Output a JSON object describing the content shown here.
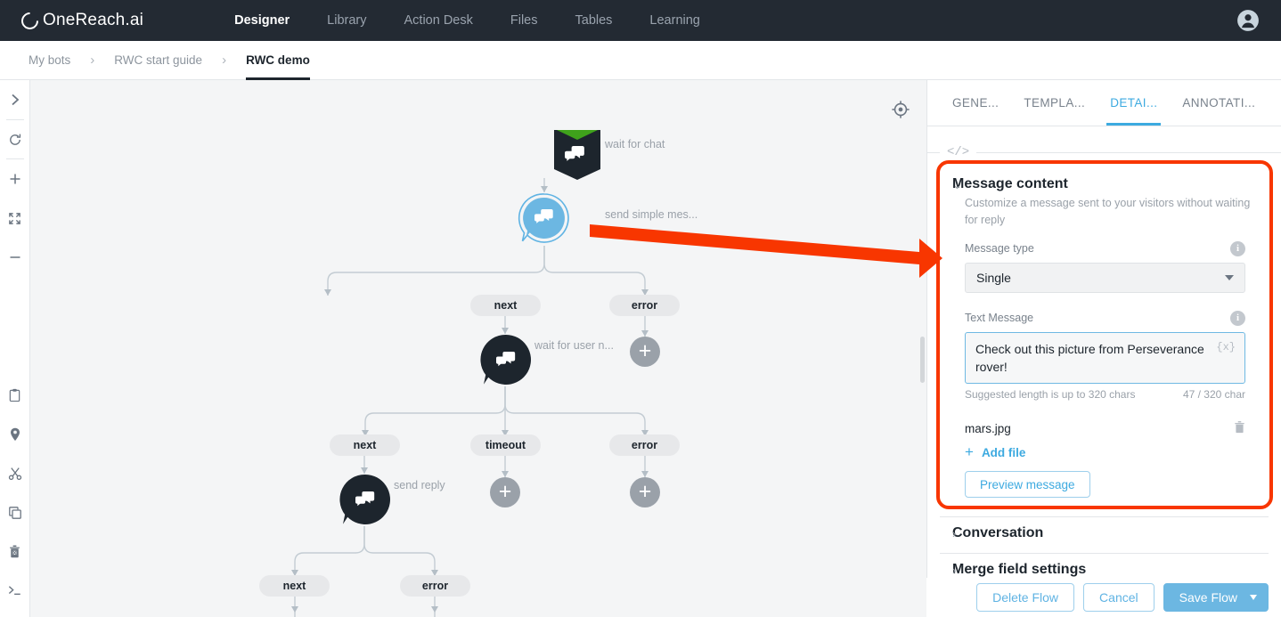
{
  "app": {
    "logo_text": "OneReach.ai"
  },
  "nav": {
    "items": [
      {
        "label": "Designer",
        "active": true
      },
      {
        "label": "Library",
        "active": false
      },
      {
        "label": "Action Desk",
        "active": false
      },
      {
        "label": "Files",
        "active": false
      },
      {
        "label": "Tables",
        "active": false
      },
      {
        "label": "Learning",
        "active": false
      }
    ]
  },
  "breadcrumb": {
    "items": [
      "My bots",
      "RWC start guide",
      "RWC demo"
    ],
    "separator": "›"
  },
  "toolbar": {
    "items": [
      {
        "name": "expand-panel-icon",
        "glyph": "chevron-right"
      },
      {
        "name": "reset-icon",
        "glyph": "refresh"
      },
      {
        "name": "zoom-in-icon",
        "glyph": "plus"
      },
      {
        "name": "fit-screen-icon",
        "glyph": "expand"
      },
      {
        "name": "zoom-out-icon",
        "glyph": "minus"
      },
      {
        "name": "clipboard-icon",
        "glyph": "clipboard"
      },
      {
        "name": "pin-icon",
        "glyph": "pin"
      },
      {
        "name": "cut-icon",
        "glyph": "scissors"
      },
      {
        "name": "copy-icon",
        "glyph": "copy"
      },
      {
        "name": "delete-icon",
        "glyph": "trash"
      },
      {
        "name": "console-icon",
        "glyph": "terminal"
      }
    ]
  },
  "canvas": {
    "recenter_icon": "crosshair-icon",
    "nodes": [
      {
        "id": "wait-for-chat",
        "label": "wait for chat",
        "type": "start"
      },
      {
        "id": "send-simple-message",
        "label": "send simple mes...",
        "type": "selected-bubble"
      },
      {
        "id": "wait-for-user",
        "label": "wait for user n...",
        "type": "bubble"
      },
      {
        "id": "send-reply",
        "label": "send reply",
        "type": "bubble"
      }
    ],
    "branch_pills": [
      {
        "label": "next"
      },
      {
        "label": "error"
      },
      {
        "label": "next"
      },
      {
        "label": "timeout"
      },
      {
        "label": "error"
      },
      {
        "label": "next"
      },
      {
        "label": "error"
      }
    ]
  },
  "panel": {
    "tabs": [
      {
        "label": "GENE...",
        "active": false
      },
      {
        "label": "TEMPLA...",
        "active": false
      },
      {
        "label": "DETAI...",
        "active": true
      },
      {
        "label": "ANNOTATI...",
        "active": false
      }
    ],
    "code_icon": "</>",
    "message_content": {
      "title": "Message content",
      "description": "Customize a message sent to your visitors without waiting for reply",
      "message_type_label": "Message type",
      "message_type_value": "Single",
      "text_message_label": "Text Message",
      "text_message_value": "Check out this picture from Perseverance rover!",
      "merge_token": "{x}",
      "hint_left": "Suggested length is up to 320 chars",
      "hint_right": "47 / 320 char",
      "file_name": "mars.jpg",
      "add_file_label": "Add file",
      "preview_label": "Preview message"
    },
    "sections": [
      {
        "title": "Conversation"
      },
      {
        "title": "Merge field settings"
      }
    ]
  },
  "footer": {
    "delete_label": "Delete Flow",
    "cancel_label": "Cancel",
    "save_label": "Save Flow"
  },
  "colors": {
    "nav_bg": "#232a33",
    "accent": "#3daae0",
    "highlight": "#f83600",
    "node_dark": "#1d252d",
    "node_green": "#3fa21b"
  }
}
